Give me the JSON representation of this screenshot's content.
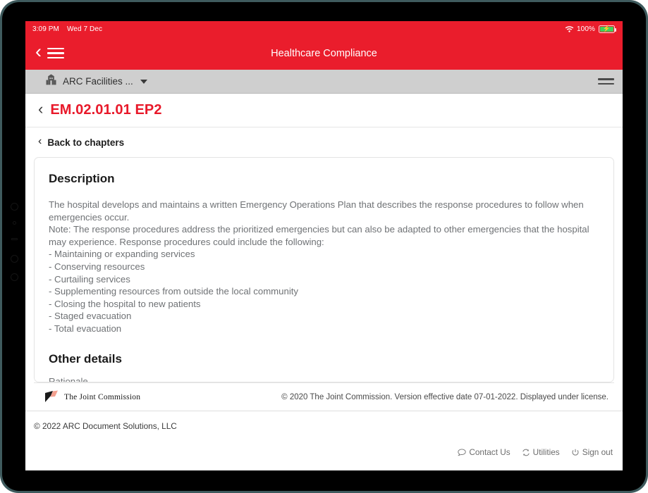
{
  "status_bar": {
    "time": "3:09 PM",
    "date": "Wed 7 Dec",
    "wifi_icon": "wifi-icon",
    "battery_percent": "100%",
    "battery_icon": "battery-charging-icon"
  },
  "nav": {
    "back_icon": "chevron-left-icon",
    "menu_icon": "hamburger-menu-icon",
    "title": "Healthcare Compliance"
  },
  "facility_bar": {
    "building_icon": "building-icon",
    "label": "ARC Facilities ...",
    "caret_icon": "chevron-down-icon",
    "menu_icon": "hamburger-menu-icon"
  },
  "page": {
    "back_icon": "chevron-left-icon",
    "title": "EM.02.01.01 EP2",
    "back_to_chapters_icon": "chevron-left-icon",
    "back_to_chapters": "Back to chapters"
  },
  "content": {
    "description_heading": "Description",
    "paragraph_1": "The hospital develops and maintains a written Emergency Operations Plan that describes the response procedures to follow when emergencies occur.",
    "paragraph_2": "Note: The response procedures address the prioritized emergencies but can also be adapted to other emergencies that the hospital may experience. Response procedures could include the following:",
    "list": [
      "- Maintaining or expanding services",
      "- Conserving resources",
      "- Curtailing services",
      "- Supplementing resources from outside the local community",
      "- Closing the hospital to new patients",
      "- Staged evacuation",
      "- Total evacuation"
    ],
    "other_details_heading": "Other details",
    "rationale_label": "Rationale"
  },
  "commission_footer": {
    "logo_icon": "joint-commission-logo",
    "logo_text": "The Joint Commission",
    "copyright": "© 2020 The Joint Commission. Version effective date 07-01-2022. Displayed under license."
  },
  "app_footer": {
    "copyright": "© 2022 ARC Document Solutions, LLC",
    "links": [
      {
        "label": "Contact Us",
        "icon": "chat-bubble-icon"
      },
      {
        "label": "Utilities",
        "icon": "refresh-icon"
      },
      {
        "label": "Sign out",
        "icon": "power-icon"
      }
    ]
  },
  "colors": {
    "brand_red": "#ea1d2c",
    "title_red": "#e8192a",
    "facility_bar_gray": "#cfcfcf",
    "body_text_gray": "#6f7275",
    "battery_green": "#41d05a"
  }
}
